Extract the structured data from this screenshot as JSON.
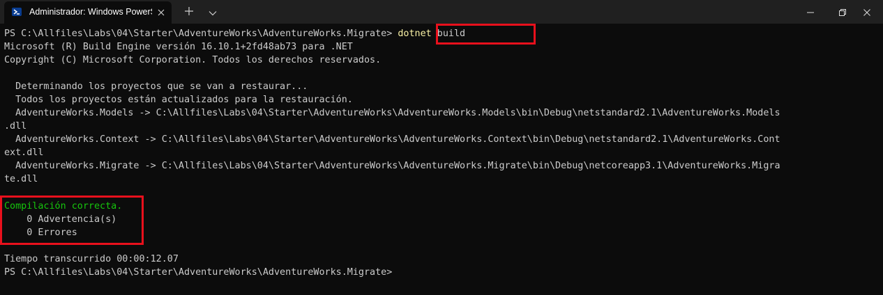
{
  "window": {
    "tab_title": "Administrador: Windows PowerShell",
    "icons": {
      "tab": "powershell-icon",
      "tab_close": "close-icon",
      "new_tab": "plus-icon",
      "dropdown": "chevron-down-icon",
      "minimize": "minimize-icon",
      "maximize": "restore-icon",
      "close": "close-icon"
    }
  },
  "terminal": {
    "prompt1": "PS C:\\Allfiles\\Labs\\04\\Starter\\AdventureWorks\\AdventureWorks.Migrate> ",
    "cmd_name": "dotnet",
    "cmd_args": " build",
    "output": [
      "Microsoft (R) Build Engine versión 16.10.1+2fd48ab73 para .NET",
      "Copyright (C) Microsoft Corporation. Todos los derechos reservados.",
      "",
      "  Determinando los proyectos que se van a restaurar...",
      "  Todos los proyectos están actualizados para la restauración.",
      "  AdventureWorks.Models -> C:\\Allfiles\\Labs\\04\\Starter\\AdventureWorks\\AdventureWorks.Models\\bin\\Debug\\netstandard2.1\\AdventureWorks.Models",
      ".dll",
      "  AdventureWorks.Context -> C:\\Allfiles\\Labs\\04\\Starter\\AdventureWorks\\AdventureWorks.Context\\bin\\Debug\\netstandard2.1\\AdventureWorks.Cont",
      "ext.dll",
      "  AdventureWorks.Migrate -> C:\\Allfiles\\Labs\\04\\Starter\\AdventureWorks\\AdventureWorks.Migrate\\bin\\Debug\\netcoreapp3.1\\AdventureWorks.Migra",
      "te.dll",
      ""
    ],
    "build_success": "Compilación correcta.",
    "warnings": "    0 Advertencia(s)",
    "errors": "    0 Errores",
    "elapsed": "Tiempo transcurrido 00:00:12.07",
    "prompt2": "PS C:\\Allfiles\\Labs\\04\\Starter\\AdventureWorks\\AdventureWorks.Migrate>"
  },
  "colors": {
    "background": "#0c0c0c",
    "text": "#cccccc",
    "command": "#f9f1a5",
    "success": "#16c60c",
    "highlight_border": "#e8101c"
  }
}
